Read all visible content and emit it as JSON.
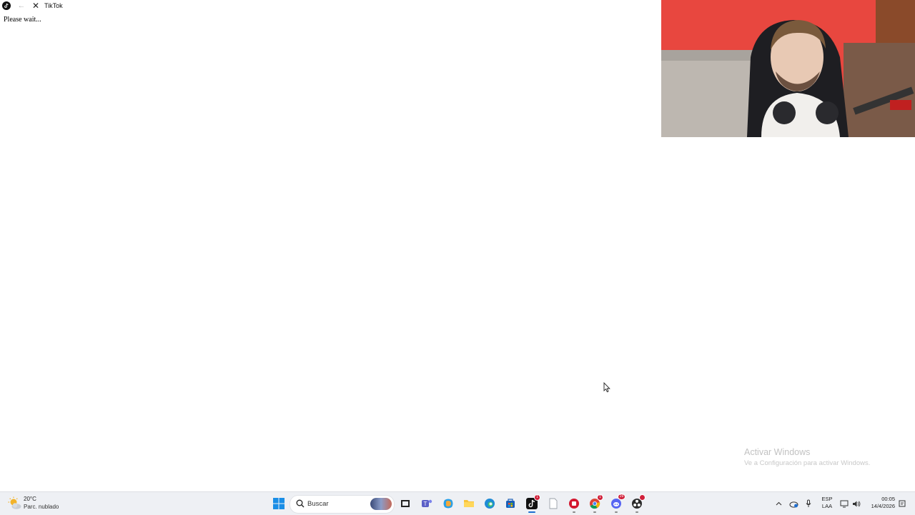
{
  "window": {
    "title": "TikTok",
    "icon": "tiktok-icon",
    "back_icon": "back-arrow-icon",
    "close_icon": "close-icon",
    "body_text": "Please wait..."
  },
  "watermark": {
    "title": "Activar Windows",
    "subtitle": "Ve a Configuración para activar Windows."
  },
  "taskbar": {
    "weather": {
      "temp": "20°C",
      "condition": "Parc. nublado",
      "icon": "weather-partly-cloudy-icon"
    },
    "search_placeholder": "Buscar",
    "apps": [
      {
        "name": "start-icon"
      },
      {
        "name": "task-view-icon"
      },
      {
        "name": "teams-icon"
      },
      {
        "name": "copilot-icon"
      },
      {
        "name": "file-explorer-icon"
      },
      {
        "name": "edge-icon"
      },
      {
        "name": "store-icon"
      },
      {
        "name": "tiktok-icon",
        "badge": "1"
      },
      {
        "name": "notepad-icon"
      },
      {
        "name": "app-red-icon"
      },
      {
        "name": "chrome-icon",
        "badge": "1"
      },
      {
        "name": "discord-icon",
        "badge": "29"
      },
      {
        "name": "obs-icon"
      }
    ],
    "tray": {
      "language_line1": "ESP",
      "language_line2": "LAA",
      "time": "00:05",
      "date": "14/4/2026"
    }
  },
  "colors": {
    "taskbar_bg": "#eef0f4",
    "accent": "#1f6fd1",
    "badge": "#d0203a"
  }
}
